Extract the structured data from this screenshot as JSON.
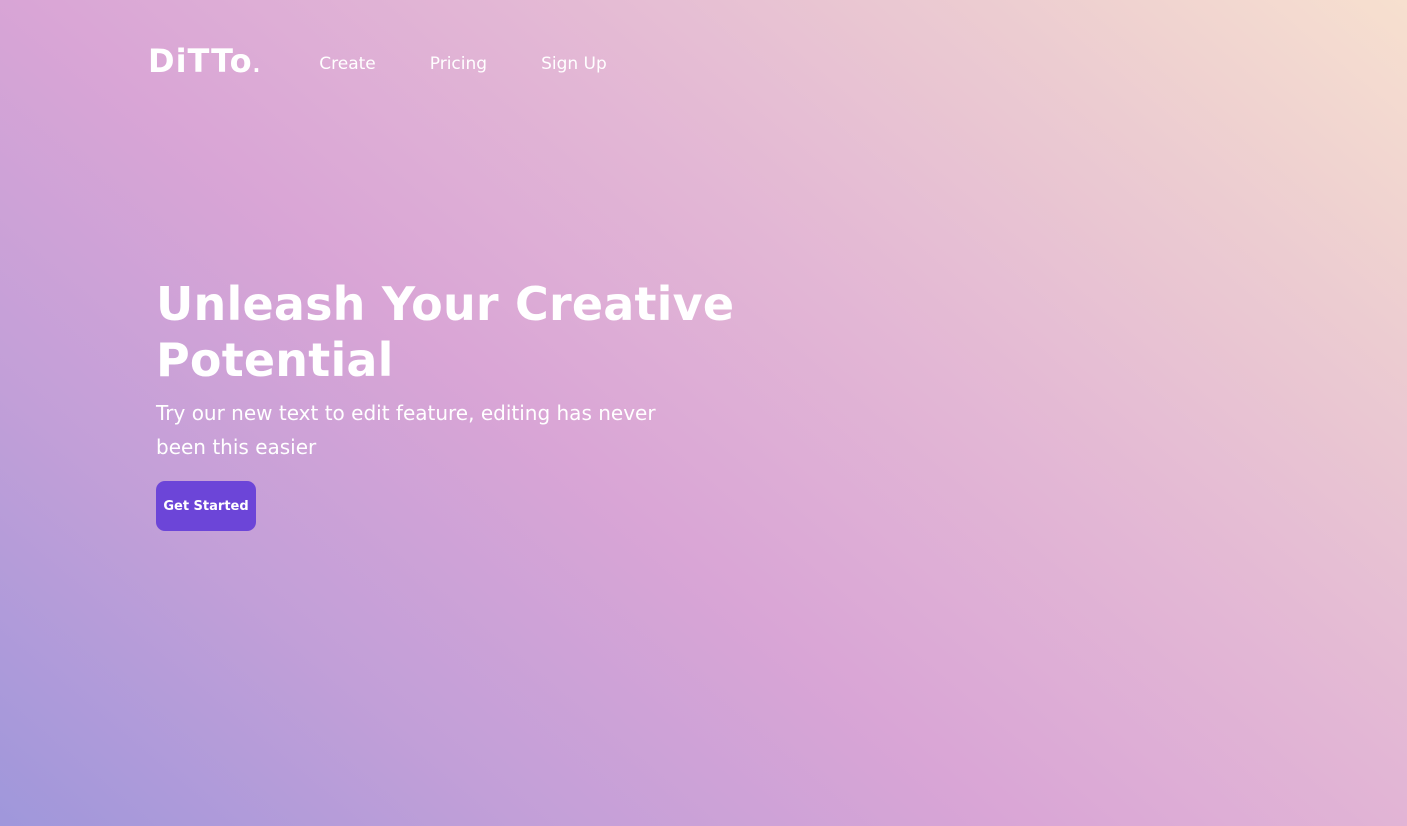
{
  "brand": {
    "logo_text": "DiTTo",
    "logo_dot": "."
  },
  "nav": {
    "links": [
      {
        "label": "Create"
      },
      {
        "label": "Pricing"
      },
      {
        "label": "Sign Up"
      }
    ]
  },
  "hero": {
    "title": "Unleash Your Creative Potential",
    "subtitle": "Try our new text to edit feature, editing has never been this easier",
    "cta_label": "Get Started"
  },
  "colors": {
    "cta_background": "#6c45d8",
    "text": "#ffffff",
    "gradient_start": "#9f97db",
    "gradient_mid": "#d9a5d6",
    "gradient_end": "#f7e0cf"
  }
}
